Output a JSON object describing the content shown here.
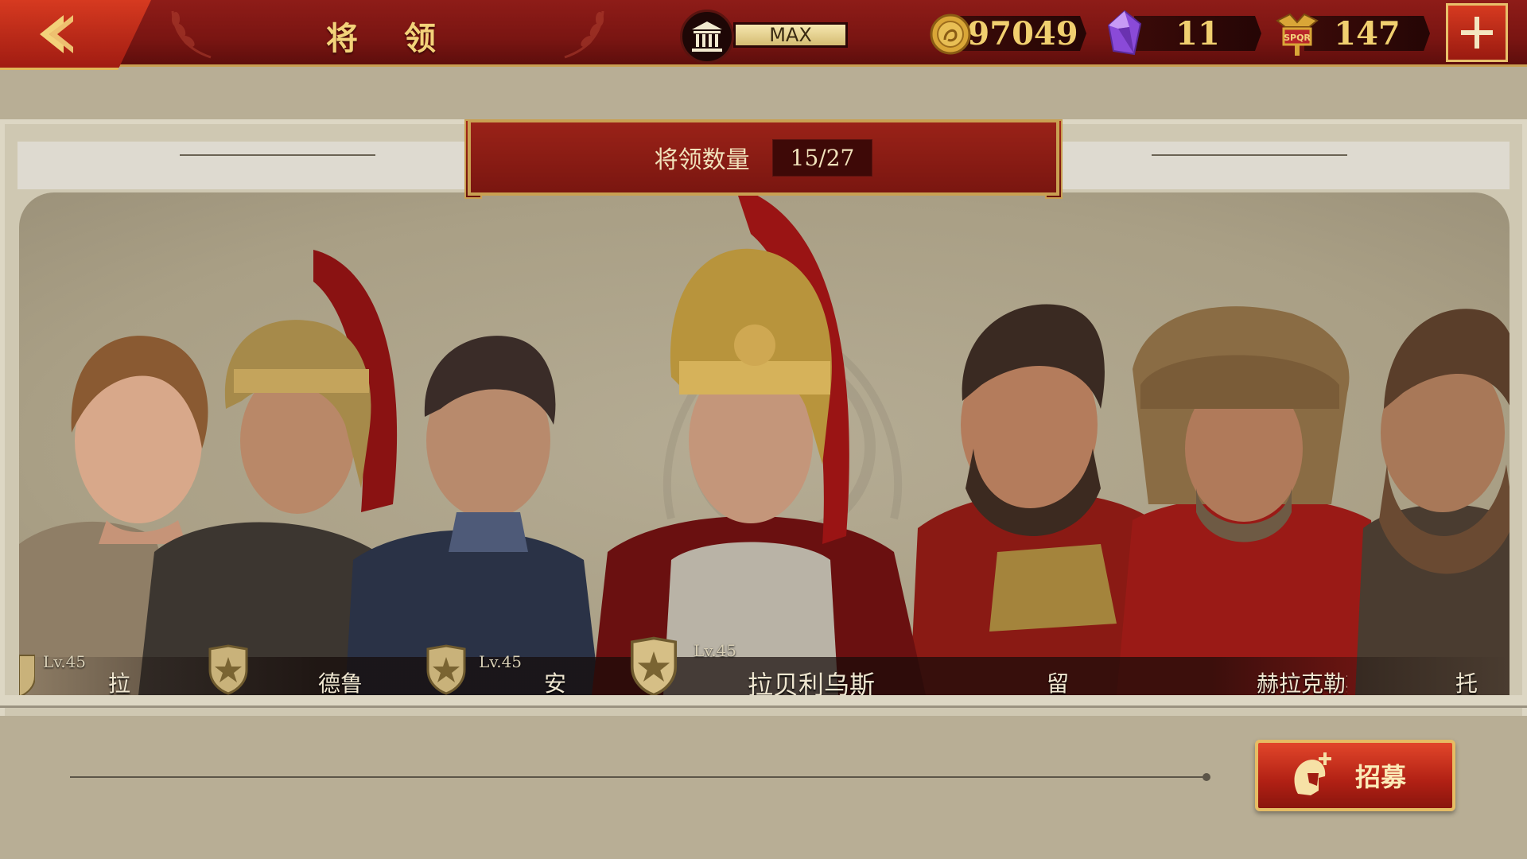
{
  "header": {
    "title": "将 领",
    "building_level": "MAX",
    "gold": "97049",
    "gems": "11",
    "spqr_tokens": "147"
  },
  "roster": {
    "count_label": "将领数量",
    "count_value": "15/27"
  },
  "heroes": [
    {
      "name": "拉",
      "level": "Lv.45"
    },
    {
      "name": "德鲁",
      "level": ""
    },
    {
      "name": "安",
      "level": "Lv.45"
    },
    {
      "name": "拉贝利乌斯",
      "level": "Lv.45"
    },
    {
      "name": "留",
      "level": ""
    },
    {
      "name": "赫拉克勒斯",
      "level": ""
    },
    {
      "name": "托",
      "level": ""
    }
  ],
  "actions": {
    "recruit_label": "招募"
  },
  "colors": {
    "header_red": "#7a1512",
    "gold_text": "#f1cf6f",
    "panel_bg": "#b8ae95",
    "button_red": "#b02014"
  }
}
